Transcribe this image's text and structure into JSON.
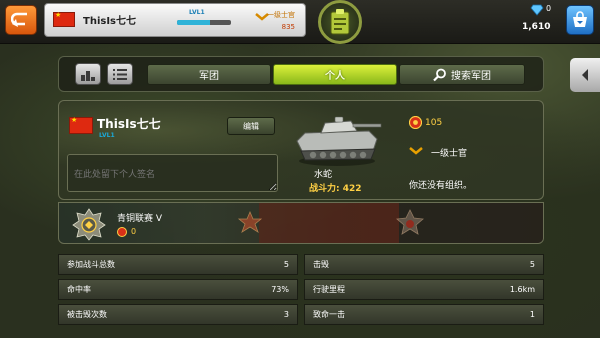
{
  "topbar": {
    "player_name": "ThisIs七七",
    "level": "LVL1",
    "xp_fraction": 0.62,
    "rank": "一级士官",
    "ore": "835",
    "diamonds": "0",
    "silver": "1,610"
  },
  "tabs": [
    {
      "label": "军团",
      "active": false
    },
    {
      "label": "个人",
      "active": true
    },
    {
      "label": "搜索军团",
      "active": false
    }
  ],
  "profile": {
    "name": "ThisIs七七",
    "level": "LVL1",
    "edit_label": "编辑",
    "signature_placeholder": "在此处留下个人签名",
    "tank_name": "水蛇",
    "battle_power": "战斗力: 422",
    "medals": "105",
    "rank": "一级士官",
    "guild_status": "你还没有组织。"
  },
  "league": {
    "name": "青铜联赛 V",
    "score": "0"
  },
  "stats": [
    {
      "label": "参加战斗总数",
      "value": "5"
    },
    {
      "label": "击毁",
      "value": "5"
    },
    {
      "label": "命中率",
      "value": "73%"
    },
    {
      "label": "行驶里程",
      "value": "1.6km"
    },
    {
      "label": "被击毁次数",
      "value": "3"
    },
    {
      "label": "致命一击",
      "value": "1"
    }
  ],
  "colors": {
    "accent_green": "#c8e02e",
    "gold": "#ffd044",
    "flag_red": "#de2910"
  }
}
